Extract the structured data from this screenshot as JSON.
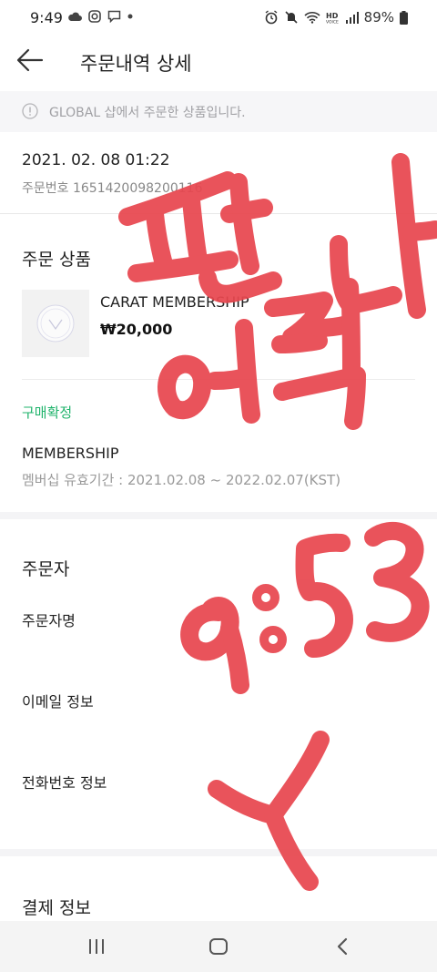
{
  "status_bar": {
    "time": "9:49",
    "battery": "89%",
    "left_icons": [
      "cloud-icon",
      "instagram-icon",
      "chat-icon",
      "dot-icon"
    ],
    "right_icons": [
      "alarm-icon",
      "mute-icon",
      "wifi-icon",
      "hd-voice-icon",
      "signal-icon",
      "battery-icon"
    ]
  },
  "header": {
    "title": "주문내역 상세"
  },
  "notice": {
    "text": "GLOBAL 샵에서 주문한 상품입니다."
  },
  "order": {
    "date": "2021. 02. 08 01:22",
    "number_text": "주문번호 1651420098200116"
  },
  "products_section": {
    "title": "주문 상품",
    "product_name": "CARAT MEMBERSHIP",
    "price": "₩20,000",
    "status": "구매확정",
    "membership_title": "MEMBERSHIP",
    "membership_period": "멤버십 유효기간 : 2021.02.08 ~ 2022.02.07(KST)"
  },
  "orderer_section": {
    "title": "주문자",
    "name_label": "주문자명",
    "email_label": "이메일 정보",
    "phone_label": "전화번호 정보"
  },
  "payment_section": {
    "title": "결제 정보"
  },
  "annotation": {
    "line1": "판",
    "line2": "어려다",
    "line3": "9:53",
    "line4": "Y",
    "color": "#e8474f"
  },
  "colors": {
    "accent_green": "#1fb36b",
    "notice_bg": "#f6f6f8",
    "handwriting": "#e8474f"
  }
}
